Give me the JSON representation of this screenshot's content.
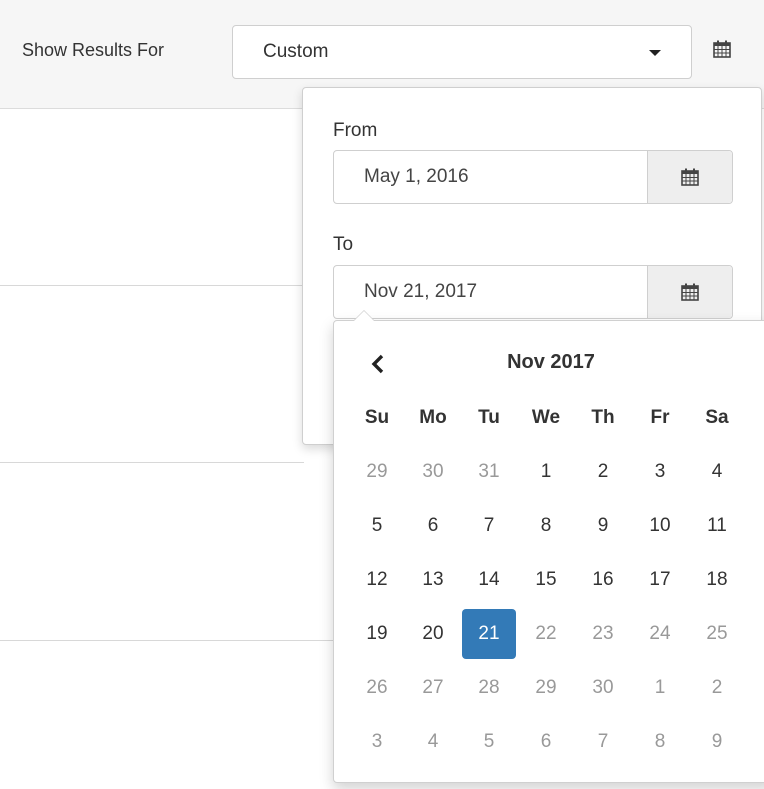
{
  "header": {
    "label": "Show Results For",
    "select_value": "Custom"
  },
  "range_panel": {
    "from_label": "From",
    "from_value": "May 1, 2016",
    "to_label": "To",
    "to_value": "Nov 21, 2017"
  },
  "datepicker": {
    "month_title": "Nov 2017",
    "weekdays": [
      "Su",
      "Mo",
      "Tu",
      "We",
      "Th",
      "Fr",
      "Sa"
    ],
    "weeks": [
      [
        "29",
        "30",
        "31",
        "1",
        "2",
        "3",
        "4"
      ],
      [
        "5",
        "6",
        "7",
        "8",
        "9",
        "10",
        "11"
      ],
      [
        "12",
        "13",
        "14",
        "15",
        "16",
        "17",
        "18"
      ],
      [
        "19",
        "20",
        "21",
        "22",
        "23",
        "24",
        "25"
      ],
      [
        "26",
        "27",
        "28",
        "29",
        "30",
        "1",
        "2"
      ],
      [
        "3",
        "4",
        "5",
        "6",
        "7",
        "8",
        "9"
      ]
    ],
    "selected_day": "21"
  },
  "colors": {
    "accent": "#337ab7",
    "muted_day": "#999999",
    "text": "#333333"
  },
  "icons": {
    "calendar": "calendar-icon",
    "prev": "chevron-left-icon",
    "dropdown": "caret-down-icon"
  }
}
